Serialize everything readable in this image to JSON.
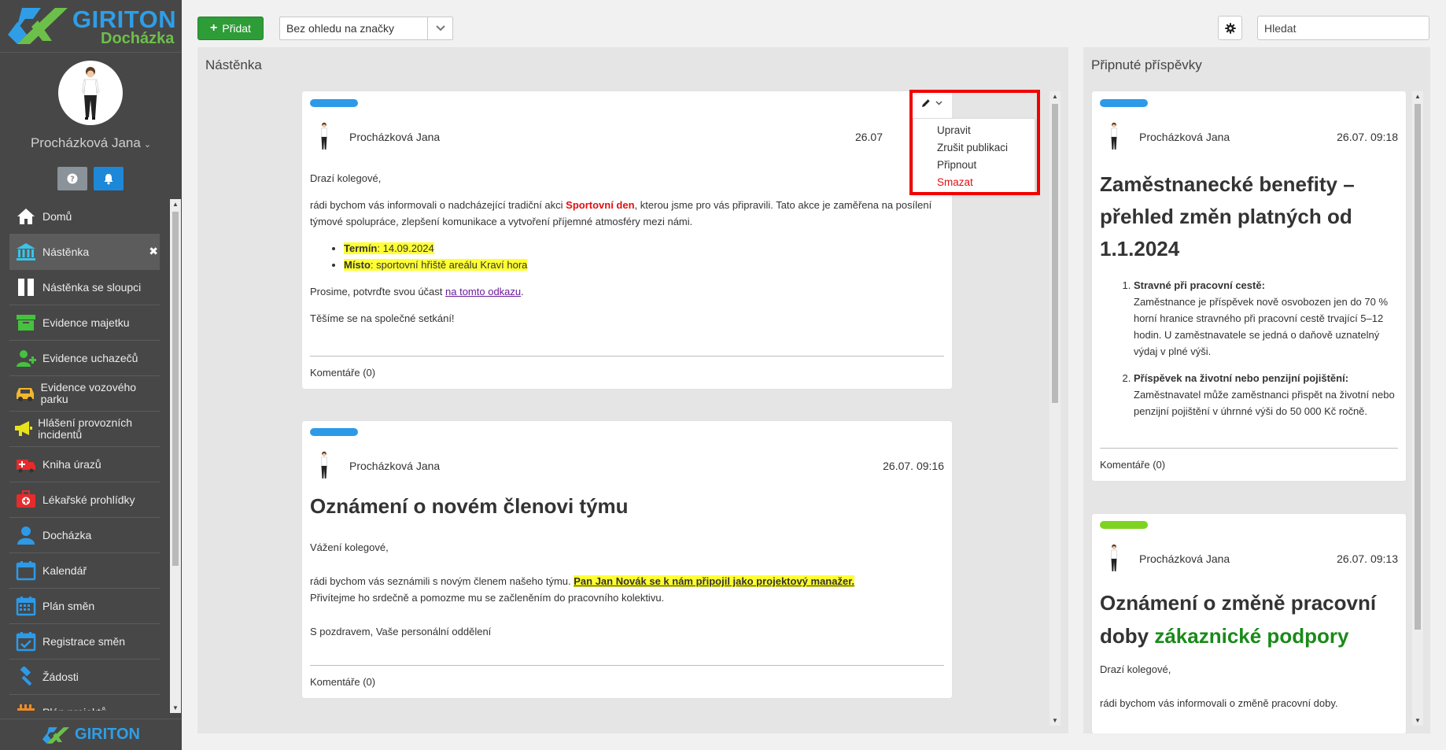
{
  "brand": {
    "name": "GIRITON",
    "subtitle": "Docházka",
    "footer_name": "GIRITON"
  },
  "user": {
    "name": "Procházková Jana"
  },
  "colors": {
    "accent_blue": "#2f9ee7",
    "brand_green": "#6cc04a",
    "add_green": "#2e9c37",
    "tag_blue": "#2d9ae8",
    "tag_green": "#7ed321",
    "danger": "#e21010"
  },
  "nav": [
    {
      "label": "Domů",
      "icon": "home-icon",
      "color": "#ffffff"
    },
    {
      "label": "Nástěnka",
      "icon": "bank-icon",
      "color": "#39c4e8",
      "active": true
    },
    {
      "label": "Nástěnka se sloupci",
      "icon": "columns-icon",
      "color": "#ffffff"
    },
    {
      "label": "Evidence majetku",
      "icon": "archive-box-icon",
      "color": "#45c23e"
    },
    {
      "label": "Evidence uchazečů",
      "icon": "user-add-icon",
      "color": "#45c23e"
    },
    {
      "label": "Evidence vozového parku",
      "icon": "car-icon",
      "color": "#f2b72c"
    },
    {
      "label": "Hlášení provozních incidentů",
      "icon": "megaphone-icon",
      "color": "#e8e21b"
    },
    {
      "label": "Kniha úrazů",
      "icon": "ambulance-icon",
      "color": "#e52b2b"
    },
    {
      "label": "Lékařské prohlídky",
      "icon": "medkit-icon",
      "color": "#e52b2b"
    },
    {
      "label": "Docházka",
      "icon": "user-icon",
      "color": "#2d9ae8"
    },
    {
      "label": "Kalendář",
      "icon": "calendar-icon",
      "color": "#2d9ae8"
    },
    {
      "label": "Plán směn",
      "icon": "calendar-grid-icon",
      "color": "#2d9ae8"
    },
    {
      "label": "Registrace směn",
      "icon": "calendar-check-icon",
      "color": "#2d9ae8"
    },
    {
      "label": "Žádosti",
      "icon": "gavel-icon",
      "color": "#2d9ae8"
    },
    {
      "label": "Plán projektů",
      "icon": "project-icon",
      "color": "#f08a24"
    }
  ],
  "toolbar": {
    "add_label": "Přidat",
    "tag_filter_value": "Bez ohledu na značky",
    "search_placeholder": "Hledat"
  },
  "board": {
    "title": "Nástěnka",
    "posts": [
      {
        "author": "Procházková Jana",
        "date": "26.07",
        "greeting": "Drazí kolegové,",
        "p1_before": "rádi bychom vás informovali o nadcházející tradiční akci ",
        "p1_highlight": "Sportovní den",
        "p1_after": ", kterou jsme pro vás připravili. Tato akce je zaměřena na posílení týmové spolupráce, zlepšení komunikace a vytvoření příjemné atmosféry mezi námi.",
        "item1_label": "Termín",
        "item1_value": ": 14.09.2024",
        "item2_label": "Místo",
        "item2_value": ": sportovní hřiště areálu Kraví hora",
        "confirm_before": "Prosime, potvrďte svou účast ",
        "confirm_link": "na tomto odkazu",
        "confirm_after": ".",
        "closing": "Těšíme se na společné setkání!",
        "comments": "Komentáře (0)"
      },
      {
        "author": "Procházková Jana",
        "date": "26.07. 09:16",
        "title": "Oznámení o novém členovi týmu",
        "greeting": "Vážení kolegové,",
        "p1_before": "rádi bychom vás seznámili s novým členem našeho týmu. ",
        "p1_highlight": "Pan Jan Novák se k nám připojil jako projektový manažer.",
        "p1_line2": "Přivítejme ho srdečně a pomozme mu se začleněním do pracovního kolektivu.",
        "signature": "S pozdravem, Vaše personální oddělení",
        "comments": "Komentáře (0)"
      }
    ],
    "menu": {
      "items": [
        "Upravit",
        "Zrušit publikaci",
        "Připnout",
        "Smazat"
      ]
    }
  },
  "pinned": {
    "title": "Připnuté příspěvky",
    "posts": [
      {
        "author": "Procházková Jana",
        "date": "26.07. 09:18",
        "title": "Zaměstnanecké benefity – přehled změn platných od 1.1.2024",
        "item1_title": "Stravné při pracovní cestě:",
        "item1_text": "Zaměstnance je příspěvek nově osvobozen jen do 70 % horní hranice stravného při pracovní cestě trvající 5–12 hodin. U zaměstnavatele se jedná o daňově uznatelný výdaj v plné výši.",
        "item2_title": "Příspěvek na životní nebo penzijní pojištění:",
        "item2_text": "Zaměstnavatel může zaměstnanci přispět na životní nebo penzijní pojištění v úhrnné výši do 50 000 Kč ročně.",
        "comments": "Komentáře (0)"
      },
      {
        "author": "Procházková Jana",
        "date": "26.07. 09:13",
        "title_before": "Oznámení o změně pracovní doby ",
        "title_green": "zákaznické podpory",
        "greeting": "Drazí kolegové,",
        "p1": "rádi bychom vás informovali o změně pracovní doby."
      }
    ]
  }
}
